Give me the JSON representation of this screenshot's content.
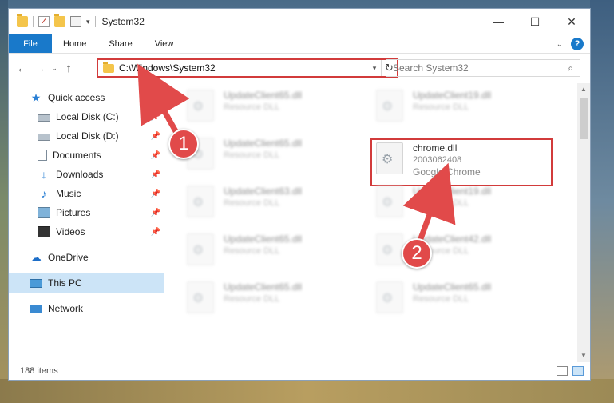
{
  "window": {
    "title": "System32"
  },
  "ribbon": {
    "tabs": [
      "File",
      "Home",
      "Share",
      "View"
    ],
    "help_label": "?"
  },
  "navbar": {
    "back": "←",
    "forward": "→",
    "recent": "⌄",
    "up": "↑",
    "address": "C:\\Windows\\System32",
    "search_placeholder": "Search System32"
  },
  "sidebar": {
    "quick_access": "Quick access",
    "items": [
      {
        "label": "Local Disk (C:)"
      },
      {
        "label": "Local Disk (D:)"
      },
      {
        "label": "Documents"
      },
      {
        "label": "Downloads"
      },
      {
        "label": "Music"
      },
      {
        "label": "Pictures"
      },
      {
        "label": "Videos"
      }
    ],
    "onedrive": "OneDrive",
    "this_pc": "This PC",
    "network": "Network"
  },
  "files": [
    {
      "name": "UpdateClient65.dll",
      "desc": "Resource DLL"
    },
    {
      "name": "UpdateClient19.dll",
      "desc": "Resource DLL"
    },
    {
      "name": "UpdateClient65.dll",
      "desc": "Resource DLL"
    },
    {
      "name": "chrome.dll",
      "size": "2003062408",
      "desc": "Google Chrome"
    },
    {
      "name": "UpdateClient63.dll",
      "desc": "Resource DLL"
    },
    {
      "name": "UpdateClient19.dll",
      "desc": "Resource DLL"
    },
    {
      "name": "UpdateClient65.dll",
      "desc": "Resource DLL"
    },
    {
      "name": "UpdateClient42.dll",
      "desc": "Resource DLL"
    },
    {
      "name": "UpdateClient65.dll",
      "desc": "Resource DLL"
    },
    {
      "name": "UpdateClient65.dll",
      "desc": "Resource DLL"
    }
  ],
  "status": {
    "item_count": "188 items"
  },
  "annotations": {
    "step1": "1",
    "step2": "2",
    "color": "#d23b3b"
  }
}
